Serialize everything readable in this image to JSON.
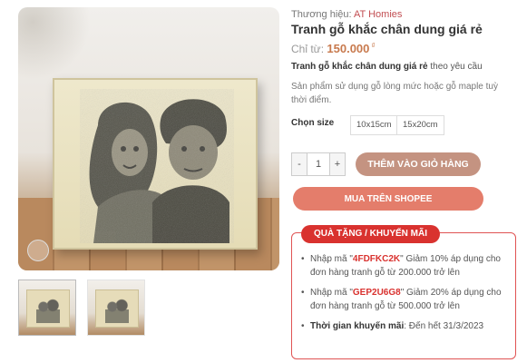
{
  "brand": {
    "label": "Thương hiệu:",
    "name": "AT Homies"
  },
  "product": {
    "title": "Tranh gỗ khắc chân dung giá rẻ",
    "price_label": "Chỉ từ:",
    "price": "150.000",
    "currency": "₫",
    "intro_bold": "Tranh gỗ khắc chân dung giá rẻ",
    "intro_rest": "theo yêu cầu",
    "description": "Sản phẩm sử dụng gỗ lòng mức hoặc gỗ maple tuỳ thời điểm."
  },
  "size": {
    "label": "Chọn size",
    "options": [
      "10x15cm",
      "15x20cm"
    ]
  },
  "quantity": {
    "minus": "-",
    "value": "1",
    "plus": "+"
  },
  "buttons": {
    "add_to_cart": "THÊM VÀO GIỎ HÀNG",
    "shopee": "MUA TRÊN SHOPEE"
  },
  "promo": {
    "header": "QUÀ TẶNG / KHUYẾN MÃI",
    "items": [
      {
        "prefix": "Nhập mã \"",
        "code": "4FDFKC2K",
        "suffix": "\" Giảm 10% áp dụng cho đơn hàng tranh gỗ từ 200.000 trở lên"
      },
      {
        "prefix": "Nhập mã \"",
        "code": "GEP2U6G8",
        "suffix": "\" Giảm 20% áp dụng cho đơn hàng tranh gỗ từ 500.000 trở lên"
      }
    ],
    "deadline_label": "Thời gian khuyến mãi",
    "deadline_value": ": Đến hết 31/3/2023"
  },
  "icons": [
    "zoom-icon"
  ],
  "colors": {
    "accent": "#c24e52",
    "price": "#c87a4e",
    "cart_button": "#c49381",
    "shopee_button": "#e47d6b",
    "promo_red": "#d9322f"
  }
}
